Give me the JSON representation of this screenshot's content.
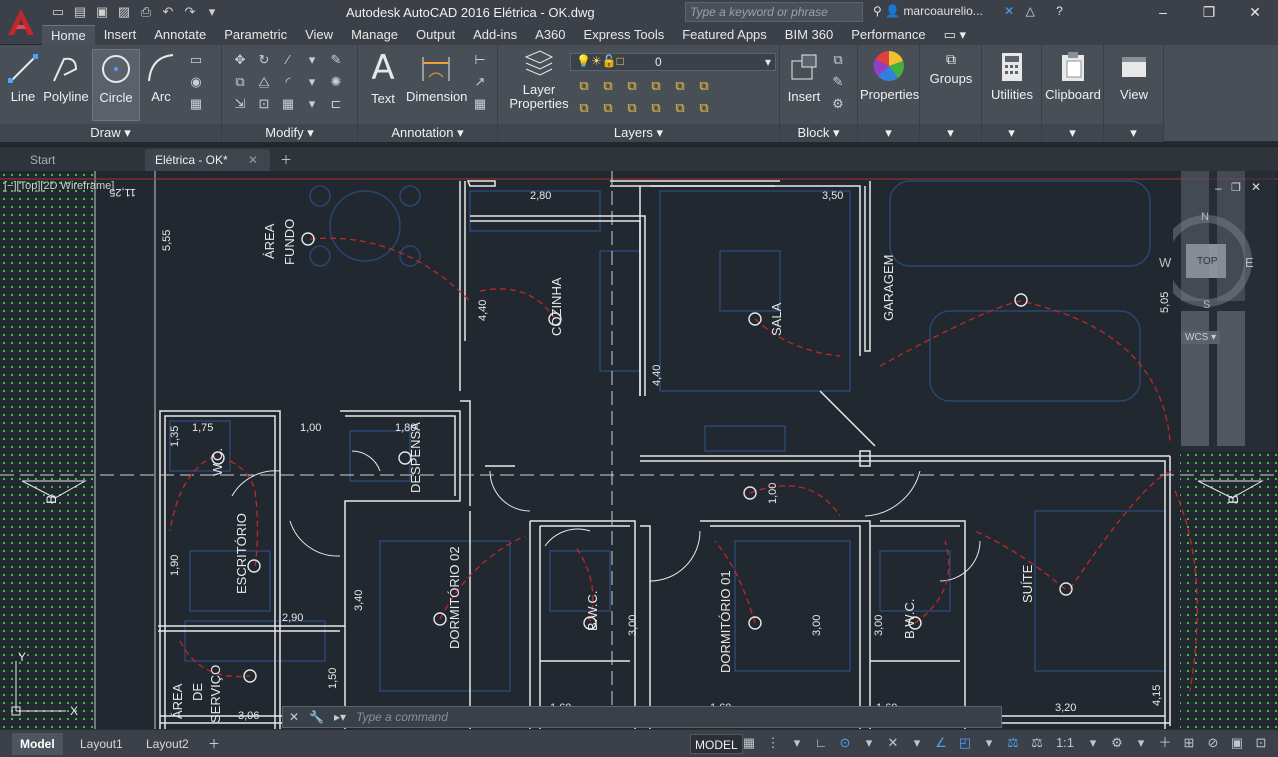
{
  "app": {
    "title": "Autodesk AutoCAD 2016    Elétrica - OK.dwg",
    "search_placeholder": "Type a keyword or phrase",
    "user": "marcoaurelio...",
    "accent": "#c1272d"
  },
  "ribbon_tabs": [
    "Home",
    "Insert",
    "Annotate",
    "Parametric",
    "View",
    "Manage",
    "Output",
    "Add-ins",
    "A360",
    "Express Tools",
    "Featured Apps",
    "BIM 360",
    "Performance"
  ],
  "ribbon": {
    "draw": {
      "label": "Draw",
      "line": "Line",
      "polyline": "Polyline",
      "circle": "Circle",
      "arc": "Arc"
    },
    "modify": {
      "label": "Modify"
    },
    "annotation": {
      "label": "Annotation",
      "text": "Text",
      "dimension": "Dimension"
    },
    "layers": {
      "label": "Layers",
      "layer_properties_1": "Layer",
      "layer_properties_2": "Properties",
      "current_layer": "0"
    },
    "block": {
      "label": "Block",
      "insert": "Insert"
    },
    "properties": "Properties",
    "groups": "Groups",
    "utilities": "Utilities",
    "clipboard": "Clipboard",
    "view": "View"
  },
  "file_tabs": [
    "Start",
    "Elétrica - OK*"
  ],
  "viewport": {
    "label": "[−][Top][2D Wireframe]",
    "cube": {
      "top": "TOP",
      "n": "N",
      "s": "S",
      "e": "E",
      "w": "W",
      "wcs": "WCS"
    }
  },
  "drawing": {
    "rooms": [
      "ÁREA",
      "FUNDO",
      "COZINHA",
      "SALA",
      "GARAGEM",
      "W.C.",
      "DESPENSA",
      "ESCRITÓRIO",
      "DORMITÓRIO 02",
      "B.W.C.",
      "DORMITÓRIO 01",
      "B.W.C.",
      "SUÍTE",
      "ÁREA",
      "DE",
      "SERVIÇO"
    ],
    "dims": [
      "11,25",
      "2,80",
      "3,50",
      "5,55",
      "5,05",
      "4,40",
      "4,40",
      "1,75",
      "1,35",
      "1,00",
      "1,80",
      "1,00",
      "1,90",
      "2,90",
      "3,40",
      "1,50",
      "3,00",
      "3,00",
      "3,00",
      "3,06",
      "1,60",
      "1,60",
      "1,60",
      "3,20",
      "4,15"
    ],
    "section_mark": "B"
  },
  "command": {
    "placeholder": "Type a command"
  },
  "layout_tabs": [
    "Model",
    "Layout1",
    "Layout2"
  ],
  "status": {
    "model": "MODEL",
    "scale": "1:1"
  }
}
